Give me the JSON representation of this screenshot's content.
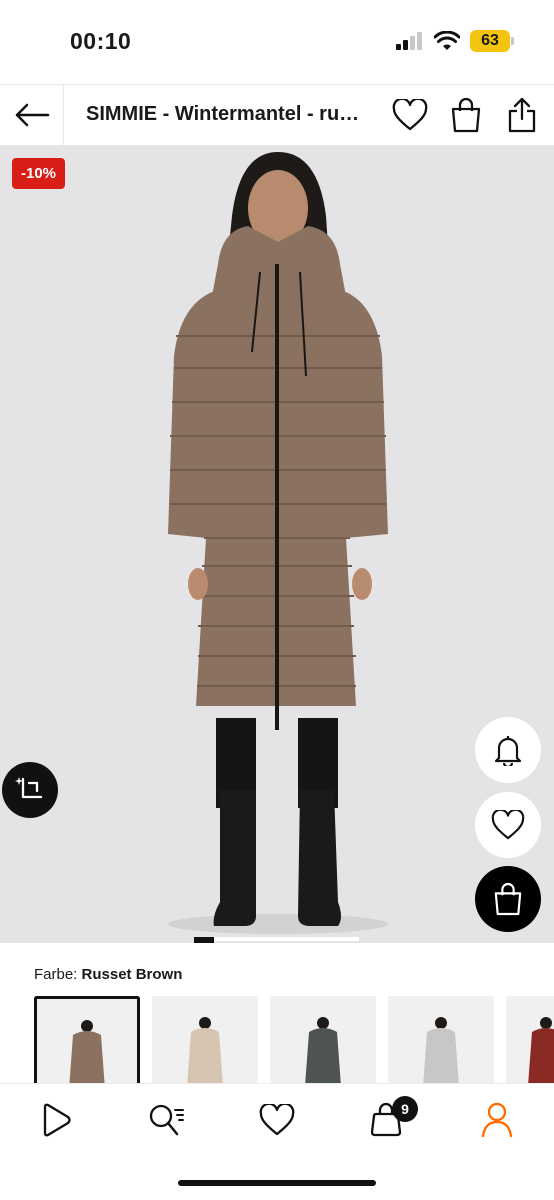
{
  "status_bar": {
    "time": "00:10",
    "battery": "63",
    "battery_color": "#f4c40f"
  },
  "header": {
    "title": "SIMMIE - Wintermantel - russet brown",
    "icons": [
      "arrow-left-icon",
      "heart-icon",
      "shopping-bag-icon",
      "share-icon"
    ]
  },
  "product": {
    "discount_badge": "-10%",
    "badge_color": "#d91e18",
    "coat_color": "#8b7260",
    "background_color": "#e4e4e6"
  },
  "color_selector": {
    "label": "Farbe:",
    "selected": "Russet Brown",
    "swatches": [
      {
        "name": "russet-brown",
        "color": "#8b7260"
      },
      {
        "name": "beige",
        "color": "#d6c5b0"
      },
      {
        "name": "dark-green",
        "color": "#4e5550"
      },
      {
        "name": "light-grey",
        "color": "#c9c7c5"
      },
      {
        "name": "red",
        "color": "#8a2a24"
      }
    ]
  },
  "bottom_nav": {
    "items": [
      "home-icon",
      "search-icon",
      "wishlist-icon",
      "cart-icon",
      "account-icon"
    ],
    "cart_count": "9",
    "account_color": "#ff6900"
  }
}
